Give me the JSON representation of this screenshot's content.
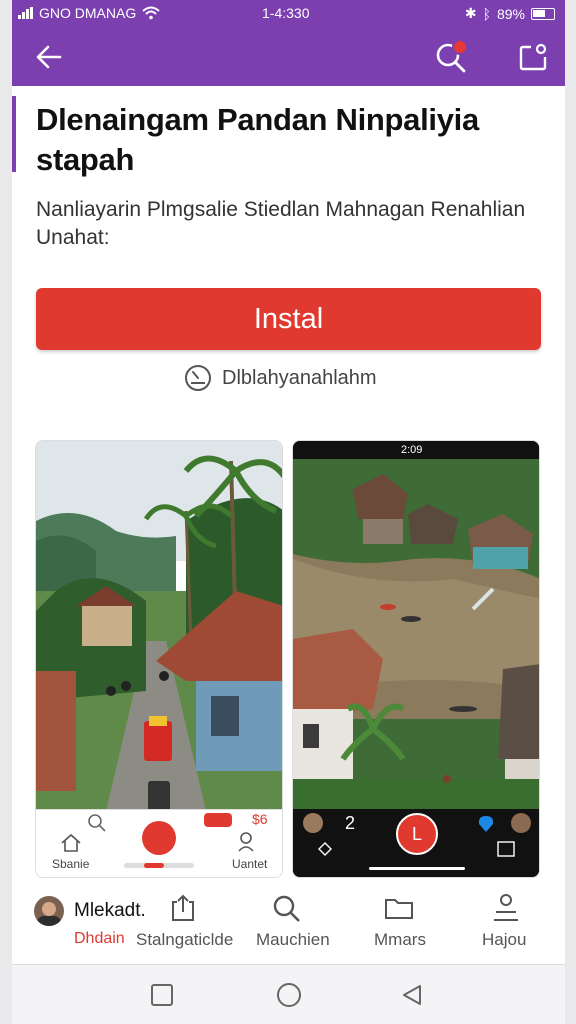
{
  "status_bar": {
    "carrier": "GNO DMANAG",
    "time": "1-4:330",
    "battery": "89%"
  },
  "app_bar": {
    "back_icon": "arrow-left-icon",
    "search_icon": "search-icon",
    "share_icon": "share-icon"
  },
  "app": {
    "title": "Dlenaingam Pandan Ninpaliyia stapah",
    "subtitle": "Nanliayarin Plmgsalie Stiedlan Mahnagan Renahlian Unahat:",
    "install_label": "Instal",
    "download_label": "Dlblahyanahlahm"
  },
  "screenshots": {
    "shot1": {
      "nav_home": "Sbanie",
      "nav_right": "Uantet",
      "badge": "$6"
    },
    "shot2": {
      "status_time": "2:09",
      "count": "2",
      "fab": "L"
    }
  },
  "bottom_nav": [
    {
      "label": "Mlekadt.",
      "sublabel": "Dhdain",
      "icon": "avatar"
    },
    {
      "label": "Stalngaticlde",
      "icon": "upload-icon"
    },
    {
      "label": "Mauchien",
      "icon": "search-icon"
    },
    {
      "label": "Mmars",
      "icon": "folder-icon"
    },
    {
      "label": "Hajou",
      "icon": "person-icon"
    }
  ],
  "colors": {
    "brand": "#7b3fb0",
    "install": "#e03a30"
  }
}
